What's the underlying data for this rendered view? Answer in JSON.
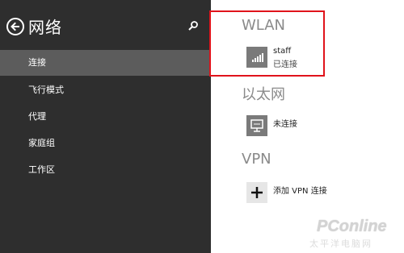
{
  "sidebar": {
    "title": "网络",
    "items": [
      {
        "label": "连接",
        "active": true
      },
      {
        "label": "飞行模式",
        "active": false
      },
      {
        "label": "代理",
        "active": false
      },
      {
        "label": "家庭组",
        "active": false
      },
      {
        "label": "工作区",
        "active": false
      }
    ]
  },
  "main": {
    "wlan": {
      "heading": "WLAN",
      "network_name": "staff",
      "network_status": "已连接",
      "icon": "wifi-signal-icon"
    },
    "ethernet": {
      "heading": "以太网",
      "status_label": "未连接",
      "icon": "ethernet-monitor-icon"
    },
    "vpn": {
      "heading": "VPN",
      "add_label": "添加 VPN 连接",
      "icon": "plus-icon"
    }
  },
  "watermark": {
    "main": "PConline",
    "sub": "太平洋电脑网"
  },
  "colors": {
    "sidebar_bg": "#2e2e2e",
    "active_item_bg": "#5c5c5c",
    "tile_bg": "#7a7a7a",
    "highlight": "#e0131b",
    "heading": "#8a8a8a"
  }
}
